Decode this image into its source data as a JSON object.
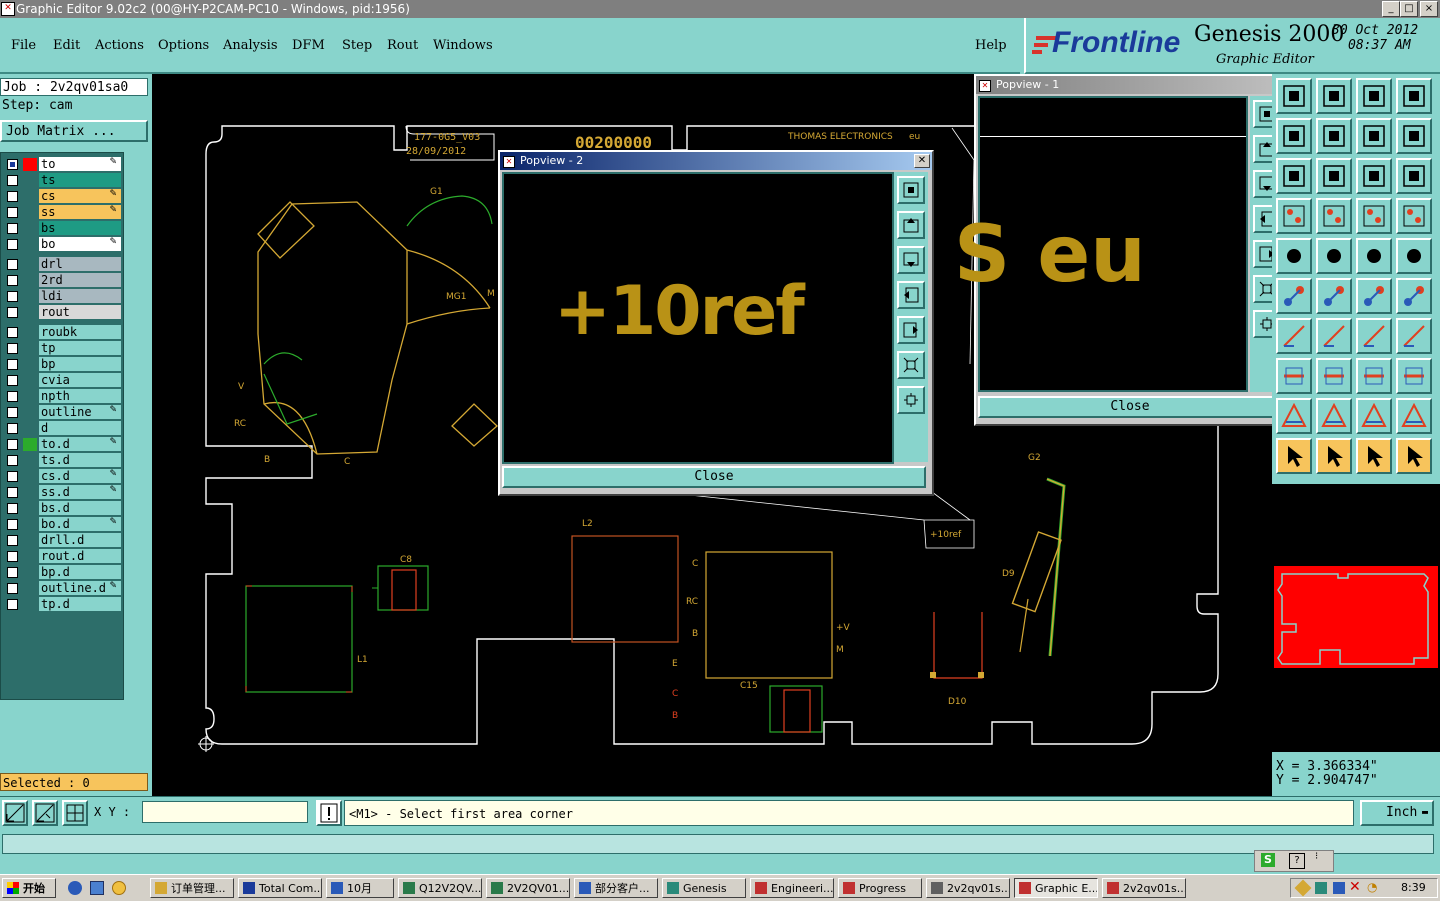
{
  "window": {
    "title": "Graphic Editor 9.02c2 (00@HY-P2CAM-PC10 - Windows, pid:1956)",
    "controls": [
      "_",
      "□",
      "×"
    ]
  },
  "menu": {
    "items": [
      "File",
      "Edit",
      "Actions",
      "Options",
      "Analysis",
      "DFM",
      "Step",
      "Rout",
      "Windows"
    ],
    "help": "Help"
  },
  "brand": {
    "logo": "Frontline",
    "product": "Genesis 2000",
    "subtitle": "Graphic Editor",
    "date": "30 Oct 2012",
    "time": "08:37 AM"
  },
  "job": {
    "job_line": "Job : 2v2qv01sa0",
    "step_line": "Step: cam",
    "matrix_button": "Job Matrix ..."
  },
  "layers": [
    {
      "name": "to",
      "color": "#ffffff",
      "swatch": "#ff0000",
      "edit": true
    },
    {
      "name": "ts",
      "color": "#1e9b84",
      "swatch": "",
      "edit": false
    },
    {
      "name": "cs",
      "color": "#f7c45c",
      "swatch": "",
      "edit": true
    },
    {
      "name": "ss",
      "color": "#f7c45c",
      "swatch": "",
      "edit": true
    },
    {
      "name": "bs",
      "color": "#1e9b84",
      "swatch": "",
      "edit": false
    },
    {
      "name": "bo",
      "color": "#ffffff",
      "swatch": "",
      "edit": true
    },
    {
      "name": "drl",
      "color": "#a8b8c0",
      "swatch": "",
      "edit": false
    },
    {
      "name": "2rd",
      "color": "#a8b8c0",
      "swatch": "",
      "edit": false
    },
    {
      "name": "ldi",
      "color": "#a8b8c0",
      "swatch": "",
      "edit": false
    },
    {
      "name": "rout",
      "color": "#d8d8d8",
      "swatch": "",
      "edit": false
    },
    {
      "name": "roubk",
      "color": "#88d4cc",
      "swatch": "",
      "edit": false
    },
    {
      "name": "tp",
      "color": "#88d4cc",
      "swatch": "",
      "edit": false
    },
    {
      "name": "bp",
      "color": "#88d4cc",
      "swatch": "",
      "edit": false
    },
    {
      "name": "cvia",
      "color": "#88d4cc",
      "swatch": "",
      "edit": false
    },
    {
      "name": "npth",
      "color": "#88d4cc",
      "swatch": "",
      "edit": false
    },
    {
      "name": "outline",
      "color": "#88d4cc",
      "swatch": "",
      "edit": true
    },
    {
      "name": "d",
      "color": "#88d4cc",
      "swatch": "",
      "edit": false
    },
    {
      "name": "to.d",
      "color": "#88d4cc",
      "swatch": "#2cab2c",
      "edit": true
    },
    {
      "name": "ts.d",
      "color": "#88d4cc",
      "swatch": "",
      "edit": false
    },
    {
      "name": "cs.d",
      "color": "#88d4cc",
      "swatch": "",
      "edit": true
    },
    {
      "name": "ss.d",
      "color": "#88d4cc",
      "swatch": "",
      "edit": true
    },
    {
      "name": "bs.d",
      "color": "#88d4cc",
      "swatch": "",
      "edit": false
    },
    {
      "name": "bo.d",
      "color": "#88d4cc",
      "swatch": "",
      "edit": true
    },
    {
      "name": "drll.d",
      "color": "#88d4cc",
      "swatch": "",
      "edit": false
    },
    {
      "name": "rout.d",
      "color": "#88d4cc",
      "swatch": "",
      "edit": false
    },
    {
      "name": "bp.d",
      "color": "#88d4cc",
      "swatch": "",
      "edit": false
    },
    {
      "name": "outline.d",
      "color": "#88d4cc",
      "swatch": "",
      "edit": true
    },
    {
      "name": "tp.d",
      "color": "#88d4cc",
      "swatch": "",
      "edit": false
    }
  ],
  "selected": "Selected : 0",
  "board": {
    "texts": {
      "job_code": "177-0G5_V03",
      "date": "28/09/2012",
      "serial": "00200000",
      "company": "THOMAS ELECTRONICS",
      "company_suffix": "eu",
      "ref_tag": "+10ref",
      "g1": "G1",
      "mg1": "MG1",
      "m": "M",
      "v": "V",
      "rc": "RC",
      "b": "B",
      "c": "C",
      "c8": "C8",
      "l1": "L1",
      "l2": "L2",
      "c_l2": "C",
      "rc2": "RC",
      "b2": "B",
      "e": "E",
      "c_small": "C",
      "b_small": "B",
      "plus_v": "+V",
      "m2": "M",
      "c15": "C15",
      "g2": "G2",
      "d9": "D9",
      "d10": "D10"
    },
    "colors": {
      "outline": "#ffffff",
      "silk": "#d4a834",
      "copper_green": "#2cab2c",
      "pad_red": "#e04020"
    }
  },
  "popview2": {
    "title": "Popview - 2",
    "content": "+10ref",
    "close": "Close"
  },
  "popview1": {
    "title": "Popview - 1",
    "content": "S eu",
    "close": "Close"
  },
  "coords": {
    "x": "X = 3.366334\"",
    "y": "Y = 2.904747\""
  },
  "bottom": {
    "xy_label": "X Y :",
    "xy_value": "",
    "message": "<M1> - Select first area corner",
    "units": "Inch"
  },
  "taskbar": {
    "start": "开始",
    "tasks": [
      "订单管理...",
      "Total Com...",
      "10月",
      "Q12V2QV...",
      "2V2QV01...",
      "部分客户...",
      "Genesis",
      "Engineeri...",
      "Progress",
      "2v2qv01s...",
      "Graphic E...",
      "2v2qv01s..."
    ],
    "active_index": 10,
    "clock": "8:39"
  }
}
